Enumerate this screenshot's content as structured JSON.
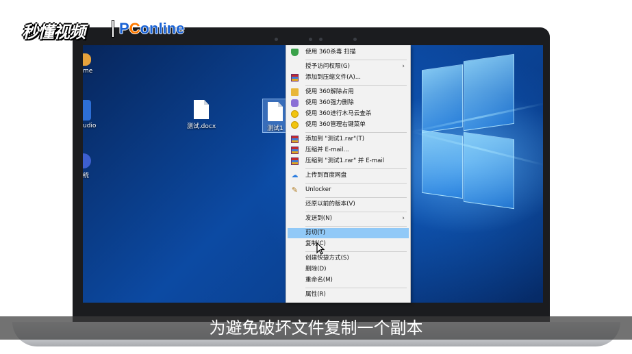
{
  "watermark": {
    "logo_left": "秒懂视频",
    "logo_right_prefix": "P",
    "logo_right_o": "C",
    "logo_right_rest": "online"
  },
  "desktop": {
    "left_edge_labels": [
      "me",
      "udio",
      "统"
    ],
    "icons": [
      {
        "label": "测试.docx",
        "selected": false
      },
      {
        "label": "测试1",
        "selected": true
      }
    ]
  },
  "context_menu": {
    "items": [
      {
        "label": "使用 360杀毒 扫描",
        "icon": "shield-icon"
      },
      {
        "label": "授予访问权限(G)",
        "submenu": true
      },
      {
        "label": "添加到压缩文件(A)...",
        "icon": "winrar-icon"
      },
      {
        "label": "使用 360解除占用",
        "icon": "folder-icon"
      },
      {
        "label": "使用 360强力删除",
        "icon": "shredder-icon"
      },
      {
        "label": "使用 360进行木马云查杀",
        "icon": "360-icon"
      },
      {
        "label": "使用 360管理右键菜单",
        "icon": "360-icon"
      },
      {
        "label": "添加到 \"测试1.rar\"(T)",
        "icon": "winrar-icon"
      },
      {
        "label": "压缩并 E-mail...",
        "icon": "winrar-icon"
      },
      {
        "label": "压缩到 \"测试1.rar\" 并 E-mail",
        "icon": "winrar-icon"
      },
      {
        "label": "上传到百度网盘",
        "icon": "baidu-cloud-icon"
      },
      {
        "label": "Unlocker",
        "icon": "unlocker-icon"
      },
      {
        "label": "还原以前的版本(V)"
      },
      {
        "label": "发送到(N)",
        "submenu": true
      },
      {
        "label": "剪切(T)",
        "highlighted": true
      },
      {
        "label": "复制(C)"
      },
      {
        "label": "创建快捷方式(S)"
      },
      {
        "label": "删除(D)"
      },
      {
        "label": "重命名(M)"
      },
      {
        "label": "属性(R)"
      }
    ]
  },
  "subtitle": "为避免破坏文件复制一个副本",
  "colors": {
    "menu_highlight": "#91c9f7",
    "desktop_blue": "#0c4aa3",
    "pconline_blue": "#1a62d4",
    "pconline_orange": "#ff7a00"
  }
}
